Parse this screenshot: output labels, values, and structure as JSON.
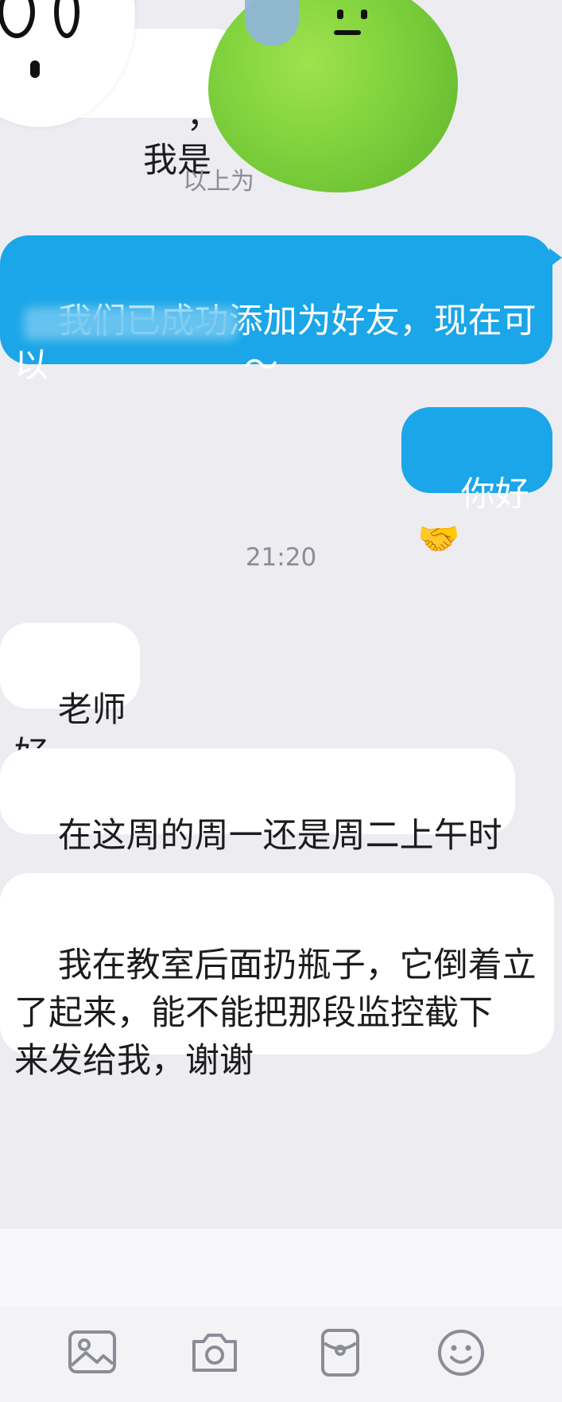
{
  "colors": {
    "outgoing_bubble": "#1aa6e8",
    "incoming_bubble": "#ffffff",
    "chat_background": "#ececf1",
    "timestamp_text": "#8a8d95",
    "toolbar_icon": "#8a8d95"
  },
  "top_partial": {
    "bubble_text": "，我是",
    "notice_text": "以上为"
  },
  "messages": [
    {
      "side": "outgoing",
      "text": "我们已成功添加为好友，现在可\n以                  ～"
    },
    {
      "side": "outgoing",
      "text": "你好🤝"
    },
    {
      "side": "incoming",
      "text": "老师好"
    },
    {
      "side": "incoming",
      "text": "在这周的周一还是周二上午时"
    },
    {
      "side": "incoming",
      "text": "我在教室后面扔瓶子，它倒着立\n了起来，能不能把那段监控截下\n来发给我，谢谢"
    }
  ],
  "timestamp": "21:20",
  "toolbar": {
    "icons": [
      "image-icon",
      "camera-icon",
      "red-packet-icon",
      "emoji-icon"
    ]
  }
}
